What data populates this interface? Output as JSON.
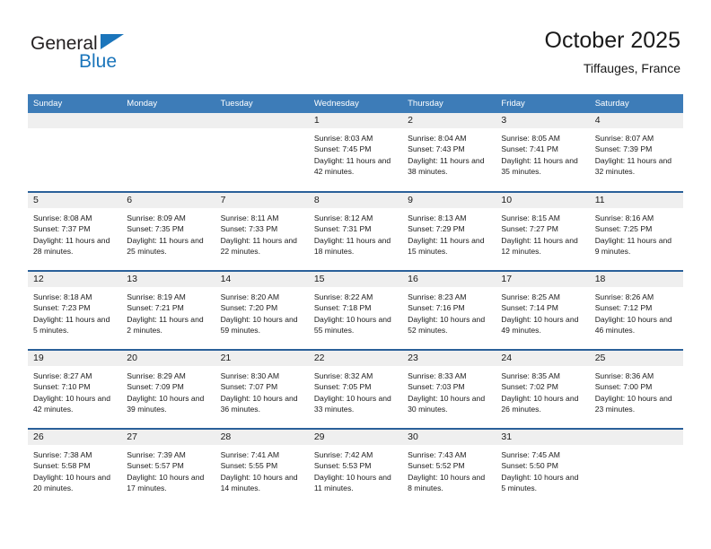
{
  "brand": {
    "name_part1": "General",
    "name_part2": "Blue",
    "triangle_color": "#1b75bb"
  },
  "header": {
    "title": "October 2025",
    "subtitle": "Tiffauges, France"
  },
  "theme": {
    "header_bar": "#3d7cb8",
    "row_divider": "#2a6099",
    "daynum_bg": "#efefef",
    "text": "#1a1a1a"
  },
  "labels": {
    "sunrise": "Sunrise:",
    "sunset": "Sunset:",
    "daylight": "Daylight:"
  },
  "weekdays": [
    "Sunday",
    "Monday",
    "Tuesday",
    "Wednesday",
    "Thursday",
    "Friday",
    "Saturday"
  ],
  "weeks": [
    [
      {
        "day": "",
        "empty": true
      },
      {
        "day": "",
        "empty": true
      },
      {
        "day": "",
        "empty": true
      },
      {
        "day": "1",
        "sunrise": "Sunrise: 8:03 AM",
        "sunset": "Sunset: 7:45 PM",
        "daylight": "Daylight: 11 hours and 42 minutes."
      },
      {
        "day": "2",
        "sunrise": "Sunrise: 8:04 AM",
        "sunset": "Sunset: 7:43 PM",
        "daylight": "Daylight: 11 hours and 38 minutes."
      },
      {
        "day": "3",
        "sunrise": "Sunrise: 8:05 AM",
        "sunset": "Sunset: 7:41 PM",
        "daylight": "Daylight: 11 hours and 35 minutes."
      },
      {
        "day": "4",
        "sunrise": "Sunrise: 8:07 AM",
        "sunset": "Sunset: 7:39 PM",
        "daylight": "Daylight: 11 hours and 32 minutes."
      }
    ],
    [
      {
        "day": "5",
        "sunrise": "Sunrise: 8:08 AM",
        "sunset": "Sunset: 7:37 PM",
        "daylight": "Daylight: 11 hours and 28 minutes."
      },
      {
        "day": "6",
        "sunrise": "Sunrise: 8:09 AM",
        "sunset": "Sunset: 7:35 PM",
        "daylight": "Daylight: 11 hours and 25 minutes."
      },
      {
        "day": "7",
        "sunrise": "Sunrise: 8:11 AM",
        "sunset": "Sunset: 7:33 PM",
        "daylight": "Daylight: 11 hours and 22 minutes."
      },
      {
        "day": "8",
        "sunrise": "Sunrise: 8:12 AM",
        "sunset": "Sunset: 7:31 PM",
        "daylight": "Daylight: 11 hours and 18 minutes."
      },
      {
        "day": "9",
        "sunrise": "Sunrise: 8:13 AM",
        "sunset": "Sunset: 7:29 PM",
        "daylight": "Daylight: 11 hours and 15 minutes."
      },
      {
        "day": "10",
        "sunrise": "Sunrise: 8:15 AM",
        "sunset": "Sunset: 7:27 PM",
        "daylight": "Daylight: 11 hours and 12 minutes."
      },
      {
        "day": "11",
        "sunrise": "Sunrise: 8:16 AM",
        "sunset": "Sunset: 7:25 PM",
        "daylight": "Daylight: 11 hours and 9 minutes."
      }
    ],
    [
      {
        "day": "12",
        "sunrise": "Sunrise: 8:18 AM",
        "sunset": "Sunset: 7:23 PM",
        "daylight": "Daylight: 11 hours and 5 minutes."
      },
      {
        "day": "13",
        "sunrise": "Sunrise: 8:19 AM",
        "sunset": "Sunset: 7:21 PM",
        "daylight": "Daylight: 11 hours and 2 minutes."
      },
      {
        "day": "14",
        "sunrise": "Sunrise: 8:20 AM",
        "sunset": "Sunset: 7:20 PM",
        "daylight": "Daylight: 10 hours and 59 minutes."
      },
      {
        "day": "15",
        "sunrise": "Sunrise: 8:22 AM",
        "sunset": "Sunset: 7:18 PM",
        "daylight": "Daylight: 10 hours and 55 minutes."
      },
      {
        "day": "16",
        "sunrise": "Sunrise: 8:23 AM",
        "sunset": "Sunset: 7:16 PM",
        "daylight": "Daylight: 10 hours and 52 minutes."
      },
      {
        "day": "17",
        "sunrise": "Sunrise: 8:25 AM",
        "sunset": "Sunset: 7:14 PM",
        "daylight": "Daylight: 10 hours and 49 minutes."
      },
      {
        "day": "18",
        "sunrise": "Sunrise: 8:26 AM",
        "sunset": "Sunset: 7:12 PM",
        "daylight": "Daylight: 10 hours and 46 minutes."
      }
    ],
    [
      {
        "day": "19",
        "sunrise": "Sunrise: 8:27 AM",
        "sunset": "Sunset: 7:10 PM",
        "daylight": "Daylight: 10 hours and 42 minutes."
      },
      {
        "day": "20",
        "sunrise": "Sunrise: 8:29 AM",
        "sunset": "Sunset: 7:09 PM",
        "daylight": "Daylight: 10 hours and 39 minutes."
      },
      {
        "day": "21",
        "sunrise": "Sunrise: 8:30 AM",
        "sunset": "Sunset: 7:07 PM",
        "daylight": "Daylight: 10 hours and 36 minutes."
      },
      {
        "day": "22",
        "sunrise": "Sunrise: 8:32 AM",
        "sunset": "Sunset: 7:05 PM",
        "daylight": "Daylight: 10 hours and 33 minutes."
      },
      {
        "day": "23",
        "sunrise": "Sunrise: 8:33 AM",
        "sunset": "Sunset: 7:03 PM",
        "daylight": "Daylight: 10 hours and 30 minutes."
      },
      {
        "day": "24",
        "sunrise": "Sunrise: 8:35 AM",
        "sunset": "Sunset: 7:02 PM",
        "daylight": "Daylight: 10 hours and 26 minutes."
      },
      {
        "day": "25",
        "sunrise": "Sunrise: 8:36 AM",
        "sunset": "Sunset: 7:00 PM",
        "daylight": "Daylight: 10 hours and 23 minutes."
      }
    ],
    [
      {
        "day": "26",
        "sunrise": "Sunrise: 7:38 AM",
        "sunset": "Sunset: 5:58 PM",
        "daylight": "Daylight: 10 hours and 20 minutes."
      },
      {
        "day": "27",
        "sunrise": "Sunrise: 7:39 AM",
        "sunset": "Sunset: 5:57 PM",
        "daylight": "Daylight: 10 hours and 17 minutes."
      },
      {
        "day": "28",
        "sunrise": "Sunrise: 7:41 AM",
        "sunset": "Sunset: 5:55 PM",
        "daylight": "Daylight: 10 hours and 14 minutes."
      },
      {
        "day": "29",
        "sunrise": "Sunrise: 7:42 AM",
        "sunset": "Sunset: 5:53 PM",
        "daylight": "Daylight: 10 hours and 11 minutes."
      },
      {
        "day": "30",
        "sunrise": "Sunrise: 7:43 AM",
        "sunset": "Sunset: 5:52 PM",
        "daylight": "Daylight: 10 hours and 8 minutes."
      },
      {
        "day": "31",
        "sunrise": "Sunrise: 7:45 AM",
        "sunset": "Sunset: 5:50 PM",
        "daylight": "Daylight: 10 hours and 5 minutes."
      },
      {
        "day": "",
        "empty": true
      }
    ]
  ]
}
